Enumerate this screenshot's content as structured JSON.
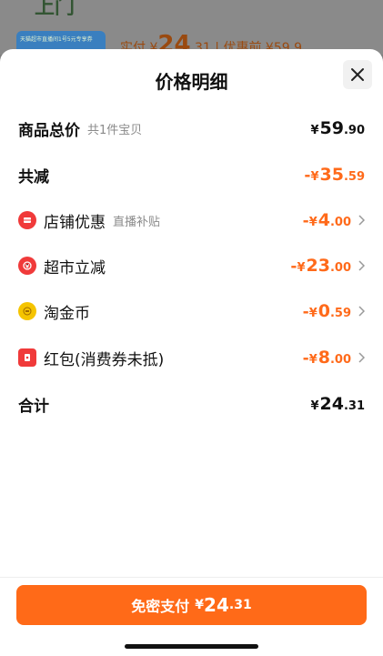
{
  "background": {
    "title": "上门",
    "thumb_text": "天猫超市直播间1号5元专享券",
    "paid_label": "实付",
    "paid_cur": "¥",
    "paid_int": "24",
    "paid_dec": ".31",
    "orig_label": "| 优惠前",
    "orig_price": "¥59.9"
  },
  "sheet": {
    "title": "价格明细",
    "rows": [
      {
        "label": "商品总价",
        "sub": "共1件宝贝",
        "prefix": "",
        "cur": "¥",
        "int": "59",
        "dec": ".90"
      },
      {
        "label": "共减",
        "sub": "",
        "prefix": "-",
        "cur": "¥",
        "int": "35",
        "dec": ".59"
      },
      {
        "label": "店铺优惠",
        "sub": "直播补贴",
        "prefix": "-",
        "cur": "¥",
        "int": "4",
        "dec": ".00",
        "icon": "shop-coupon-icon"
      },
      {
        "label": "超市立减",
        "sub": "",
        "prefix": "-",
        "cur": "¥",
        "int": "23",
        "dec": ".00",
        "icon": "supermarket-discount-icon"
      },
      {
        "label": "淘金币",
        "sub": "",
        "prefix": "-",
        "cur": "¥",
        "int": "0",
        "dec": ".59",
        "icon": "gold-coin-icon"
      },
      {
        "label": "红包(消费券未抵)",
        "sub": "",
        "prefix": "-",
        "cur": "¥",
        "int": "8",
        "dec": ".00",
        "icon": "red-envelope-icon"
      },
      {
        "label": "合计",
        "sub": "",
        "prefix": "",
        "cur": "¥",
        "int": "24",
        "dec": ".31"
      }
    ]
  },
  "footer": {
    "pay_label": "免密支付",
    "pay_cur": "¥",
    "pay_int": "24",
    "pay_dec": ".31"
  },
  "colors": {
    "accent": "#ff6a18",
    "discount_text": "#ff6a1a",
    "icon_red": "#f03a3a",
    "icon_gold": "#f5c400"
  }
}
